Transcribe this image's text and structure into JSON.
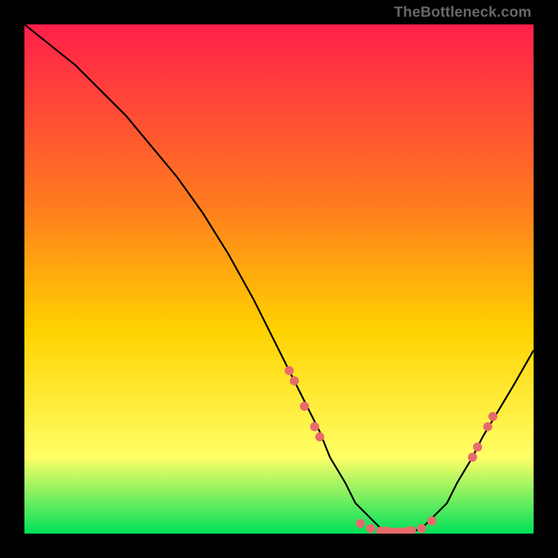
{
  "watermark": "TheBottleneck.com",
  "colors": {
    "bg": "#000000",
    "gradient_top": "#ff1f4b",
    "gradient_mid1": "#ff7a1f",
    "gradient_mid2": "#ffd200",
    "gradient_mid3": "#ffff66",
    "gradient_bottom": "#00e05a",
    "curve": "#000000",
    "marker": "#e86b6b"
  },
  "chart_data": {
    "type": "line",
    "title": "",
    "xlabel": "",
    "ylabel": "",
    "xlim": [
      0,
      100
    ],
    "ylim": [
      0,
      100
    ],
    "curve": {
      "x": [
        0,
        5,
        10,
        15,
        20,
        25,
        30,
        35,
        40,
        45,
        50,
        52,
        55,
        58,
        60,
        63,
        65,
        68,
        70,
        72,
        75,
        78,
        80,
        83,
        85,
        88,
        90,
        93,
        96,
        100
      ],
      "y": [
        100,
        96,
        92,
        87,
        82,
        76,
        70,
        63,
        55,
        46,
        36,
        32,
        26,
        20,
        15,
        10,
        6,
        3,
        1,
        0,
        0,
        1,
        3,
        6,
        10,
        15,
        19,
        24,
        29,
        36
      ]
    },
    "markers": [
      {
        "x": 52,
        "y": 32
      },
      {
        "x": 53,
        "y": 30
      },
      {
        "x": 55,
        "y": 25
      },
      {
        "x": 57,
        "y": 21
      },
      {
        "x": 58,
        "y": 19
      },
      {
        "x": 66,
        "y": 2
      },
      {
        "x": 68,
        "y": 1
      },
      {
        "x": 70,
        "y": 0.5
      },
      {
        "x": 71,
        "y": 0.5
      },
      {
        "x": 72,
        "y": 0.3
      },
      {
        "x": 73,
        "y": 0.3
      },
      {
        "x": 74,
        "y": 0.3
      },
      {
        "x": 75,
        "y": 0.4
      },
      {
        "x": 76,
        "y": 0.6
      },
      {
        "x": 78,
        "y": 1.0
      },
      {
        "x": 80,
        "y": 2.5
      },
      {
        "x": 88,
        "y": 15
      },
      {
        "x": 89,
        "y": 17
      },
      {
        "x": 91,
        "y": 21
      },
      {
        "x": 92,
        "y": 23
      }
    ]
  }
}
